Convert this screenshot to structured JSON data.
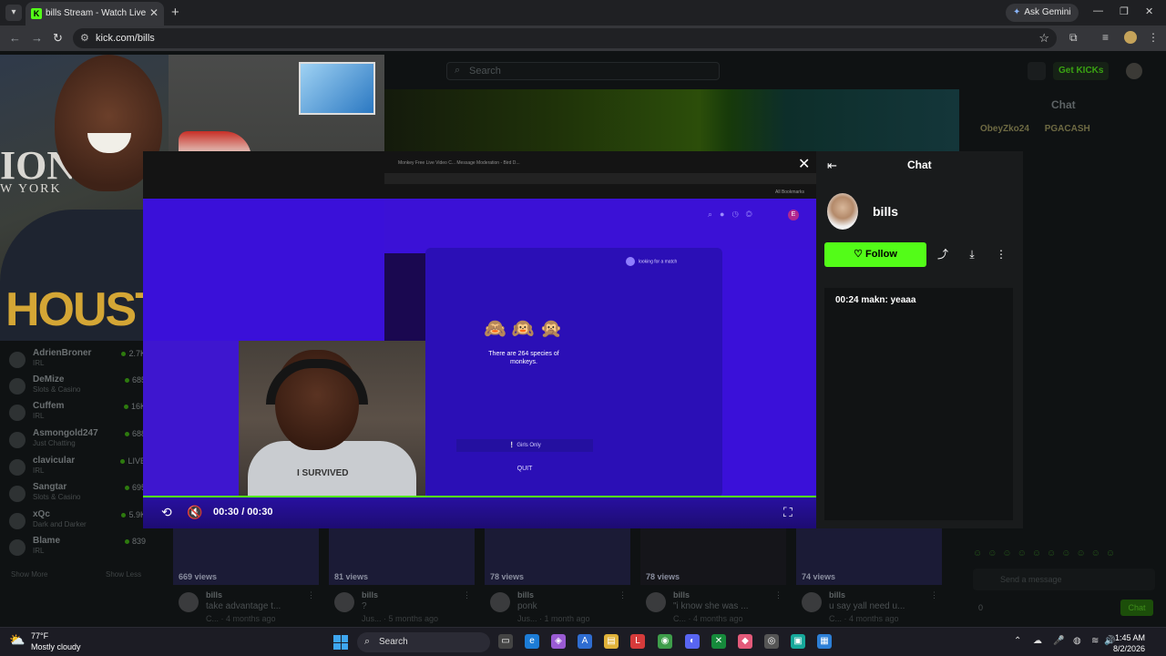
{
  "browser": {
    "tab_title": "bills Stream - Watch Live on Kick",
    "tab_favicon": "K",
    "gemini_label": "Ask Gemini",
    "url": "kick.com/bills"
  },
  "site": {
    "search_placeholder": "Search",
    "get_kicks": "Get KICKs",
    "chat_title": "Chat",
    "badges": [
      "ObeyZko24",
      "PGACASH"
    ],
    "chat_input_placeholder": "Send a message",
    "chat_button": "Chat",
    "kicks_count": "0",
    "show_more": "Show More",
    "show_less": "Show Less"
  },
  "sidebar": [
    {
      "name": "AdrienBroner",
      "category": "IRL",
      "count": "2.7K"
    },
    {
      "name": "DeMize",
      "category": "Slots & Casino",
      "count": "685"
    },
    {
      "name": "Cuffem",
      "category": "IRL",
      "count": "16K"
    },
    {
      "name": "Asmongold247",
      "category": "Just Chatting",
      "count": "688"
    },
    {
      "name": "clavicular",
      "category": "IRL",
      "count": "LIVE"
    },
    {
      "name": "Sangtar",
      "category": "Slots & Casino",
      "count": "695"
    },
    {
      "name": "xQc",
      "category": "Dark and Darker",
      "count": "5.9K"
    },
    {
      "name": "Blame",
      "category": "IRL",
      "count": "839"
    }
  ],
  "vods": [
    {
      "views": "669 views",
      "user": "bills",
      "title": "take advantage t...",
      "cat": "C...",
      "age": "4 months ago"
    },
    {
      "views": "81 views",
      "user": "bills",
      "title": "?",
      "cat": "Jus...",
      "age": "5 months ago"
    },
    {
      "views": "78 views",
      "user": "bills",
      "title": "ponk",
      "cat": "Jus...",
      "age": "1 month ago"
    },
    {
      "views": "78 views",
      "user": "bills",
      "title": "\"i know she was ...",
      "cat": "C...",
      "age": "4 months ago"
    },
    {
      "views": "74 views",
      "user": "bills",
      "title": "u say yall need u...",
      "cat": "C...",
      "age": "4 months ago"
    }
  ],
  "webcam": {
    "sign_big": "ION",
    "sign_small": "W YORK",
    "shirt_text": "HOUSTO"
  },
  "clip": {
    "match_text": "looking for a match",
    "monkeys": "🙈🙉🙊",
    "fact": "There are 264 species of monkeys.",
    "girls_only": "Girls Only",
    "quit": "QUIT",
    "bookmarks": "All Bookmarks",
    "inner_tabs": "Monkey Free Live Video C...    Message Moderation - Bird D...",
    "avatar_letter": "E",
    "cam_shirt": "I SURVIVED",
    "time": "00:30 / 00:30",
    "progress": 1.0
  },
  "modal_chat": {
    "title": "Chat",
    "channel": "bills",
    "follow": "Follow",
    "messages": [
      {
        "time": "00:24",
        "user": "makn",
        "text": "yeaaa"
      }
    ]
  },
  "taskbar": {
    "temp": "77°F",
    "weather": "Mostly cloudy",
    "search": "Search",
    "time": "1:45 AM",
    "date": "8/2/2026"
  },
  "colors": {
    "kick_green": "#53fc18",
    "clip_purple": "#3a10d9"
  }
}
